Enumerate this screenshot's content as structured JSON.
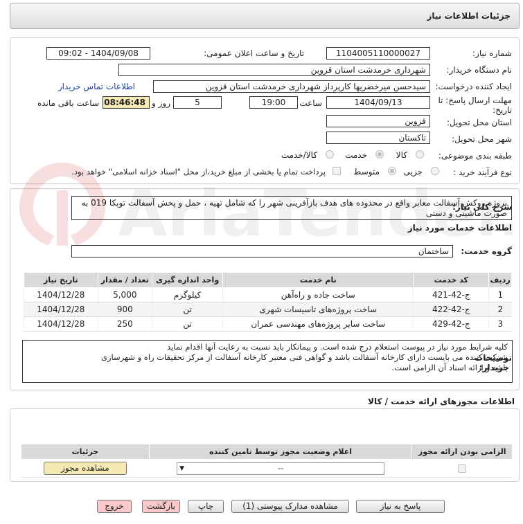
{
  "header": {
    "title": "جزئیات اطلاعات نیاز"
  },
  "watermark": "AriaTender.neT",
  "form": {
    "need_number_label": "شماره نیاز:",
    "need_number": "1104005110000027",
    "announce_label": "تاریخ و ساعت اعلان عمومی:",
    "announce_value": "1404/09/08 - 09:02",
    "buyer_label": "نام دستگاه خریدار:",
    "buyer_value": "شهرداری خرمدشت استان قزوین",
    "creator_label": "ایجاد کننده درخواست:",
    "creator_value": "سیدحسن میرخضریها کارپرداز شهرداری خرمدشت استان قزوین",
    "contact_link": "اطلاعات تماس خریدار",
    "deadline_label_1": "مهلت ارسال پاسخ: تا",
    "deadline_label_2": "تاریخ:",
    "deadline_date": "1404/09/13",
    "time_label": "ساعت",
    "deadline_time": "19:00",
    "days_value": "5",
    "days_label": "روز و",
    "remaining_time": "08:46:48",
    "remaining_label": "ساعت باقی مانده",
    "province_label": "استان محل تحویل:",
    "province_value": "قزوین",
    "city_label": "شهر محل تحویل:",
    "city_value": "تاکستان",
    "category_label": "طبقه بندی موضوعی:",
    "category_options": [
      "کالا",
      "خدمت",
      "کالا/خدمت"
    ],
    "process_label": "نوع فرآیند خرید :",
    "process_options": [
      "جزیی",
      "متوسط"
    ],
    "payment_text": "پرداخت تمام یا بخشی از مبلغ خرید،از محل \"اسناد خزانه اسلامی\" خواهد بود."
  },
  "description": {
    "label": "شرح کلی نیاز:",
    "text": "پروژه روکش آسفالت معابر واقع در محدوده های هدف بازآفرینی شهر را که شامل تهیه ، حمل و پخش آسفالت توپکا 019 به صورت ماشینی و دستی"
  },
  "services": {
    "title": "اطلاعات خدمات مورد نیاز",
    "group_label": "گروه خدمت:",
    "group_value": "ساختمان",
    "columns": [
      "ردیف",
      "کد خدمت",
      "نام خدمت",
      "واحد اندازه گیری",
      "تعداد / مقدار",
      "تاریخ نیاز"
    ],
    "rows": [
      {
        "idx": "1",
        "code": "ج-42-421",
        "name": "ساخت جاده و راه‌آهن",
        "unit": "کیلوگرم",
        "qty": "5,000",
        "date": "1404/12/28"
      },
      {
        "idx": "2",
        "code": "ج-42-422",
        "name": "ساخت پروژه‌های تاسیسات شهری",
        "unit": "تن",
        "qty": "900",
        "date": "1404/12/28"
      },
      {
        "idx": "3",
        "code": "ج-42-429",
        "name": "ساخت سایر پروژه‌های مهندسی عمران",
        "unit": "تن",
        "qty": "250",
        "date": "1404/12/28"
      }
    ]
  },
  "buyer_notes": {
    "label_1": "توضیحات",
    "label_2": "خریدار:",
    "line1": "کلیه شرایط مورد نیاز در پیوست استعلام درج شده است. و پیمانکار باید نسبت به رعایت آنها اقدام نماید",
    "line2": "شرکت کننده  می بایست دارای کارخانه آسفالت باشد و گواهی فنی معتبر کارخانه آسفالت از مرکز تحقیقات راه و شهرسازی",
    "line3": "باشد و ارائه اسناد آن الزامی است."
  },
  "permits": {
    "title": "اطلاعات مجوزهای ارائه خدمت / کالا",
    "columns": [
      "الزامی بودن ارائه مجوز",
      "اعلام وضعیت مجوز توسط تامین کننده",
      "جزئیات"
    ],
    "select_value": "--",
    "view_button": "مشاهده مجوز"
  },
  "actions": {
    "reply": "پاسخ به نیاز",
    "attachments": "مشاهده مدارک پیوستی (1)",
    "print": "چاپ",
    "back": "بازگشت",
    "exit": "خروج"
  }
}
